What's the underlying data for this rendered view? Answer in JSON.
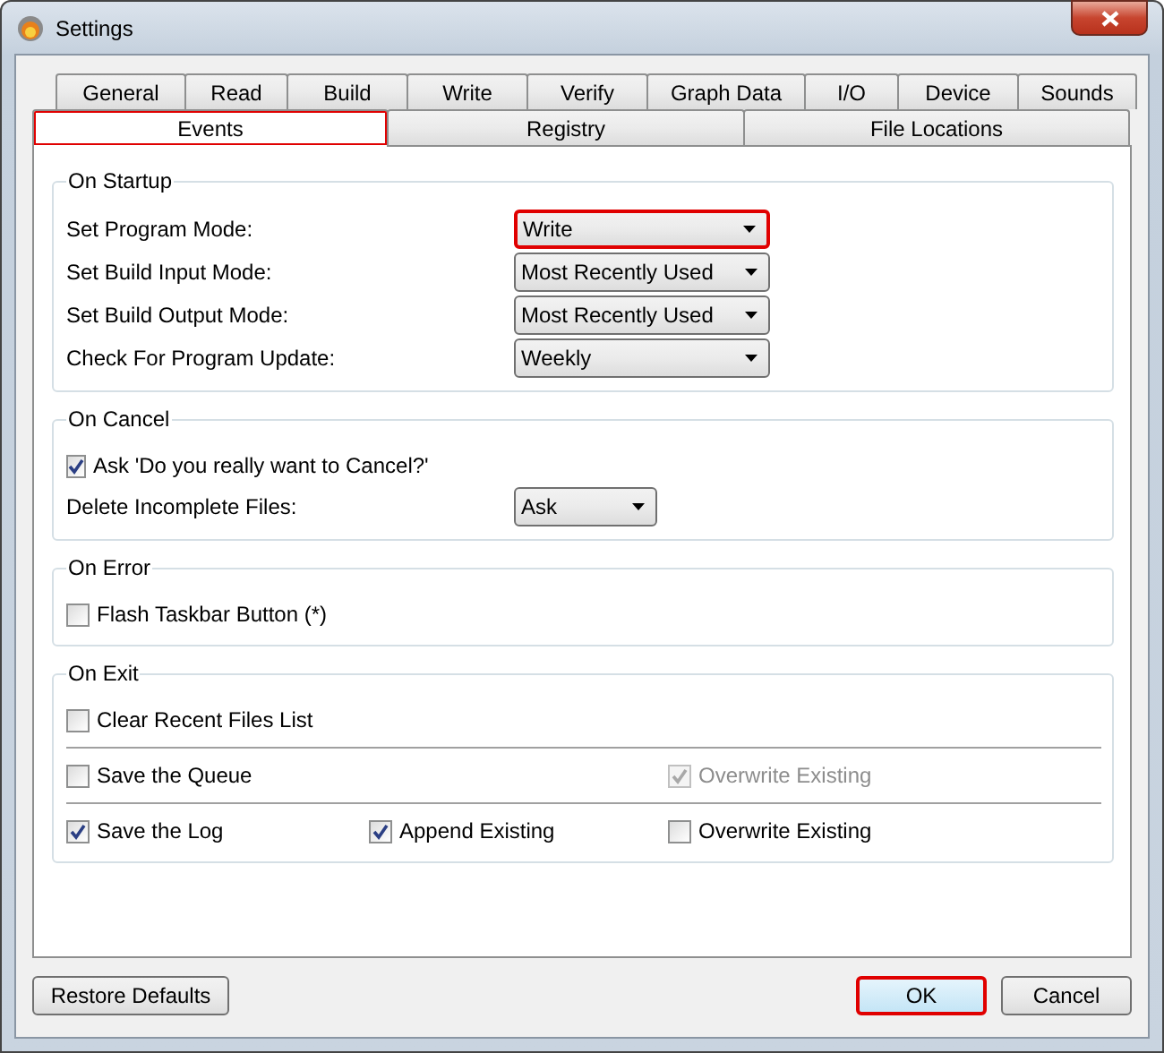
{
  "window": {
    "title": "Settings"
  },
  "tab_rows": [
    {
      "tabs": [
        {
          "label": "General",
          "selected": false,
          "highlighted": false
        },
        {
          "label": "Read",
          "selected": false,
          "highlighted": false
        },
        {
          "label": "Build",
          "selected": false,
          "highlighted": false
        },
        {
          "label": "Write",
          "selected": false,
          "highlighted": false
        },
        {
          "label": "Verify",
          "selected": false,
          "highlighted": false
        },
        {
          "label": "Graph Data",
          "selected": false,
          "highlighted": false
        },
        {
          "label": "I/O",
          "selected": false,
          "highlighted": false
        },
        {
          "label": "Device",
          "selected": false,
          "highlighted": false
        },
        {
          "label": "Sounds",
          "selected": false,
          "highlighted": false
        }
      ]
    },
    {
      "tabs": [
        {
          "label": "Events",
          "selected": true,
          "highlighted": true
        },
        {
          "label": "Registry",
          "selected": false,
          "highlighted": false
        },
        {
          "label": "File Locations",
          "selected": false,
          "highlighted": false
        }
      ]
    }
  ],
  "groups": [
    {
      "title": "On Startup",
      "rows": [
        {
          "kind": "select",
          "label": "Set Program Mode:",
          "value": "Write",
          "highlighted": true
        },
        {
          "kind": "select",
          "label": "Set Build Input Mode:",
          "value": "Most Recently Used",
          "highlighted": false
        },
        {
          "kind": "select",
          "label": "Set Build Output Mode:",
          "value": "Most Recently Used",
          "highlighted": false
        },
        {
          "kind": "select",
          "label": "Check For Program Update:",
          "value": "Weekly",
          "highlighted": false
        }
      ]
    },
    {
      "title": "On Cancel",
      "rows": [
        {
          "kind": "checks",
          "items": [
            {
              "label": "Ask 'Do you really want to Cancel?'",
              "checked": true,
              "disabled": false
            }
          ]
        },
        {
          "kind": "short_select",
          "label": "Delete Incomplete Files:",
          "value": "Ask",
          "highlighted": false
        }
      ]
    },
    {
      "title": "On Error",
      "rows": [
        {
          "kind": "checks",
          "items": [
            {
              "label": "Flash Taskbar Button (*)",
              "checked": false,
              "disabled": false
            }
          ]
        }
      ]
    },
    {
      "title": "On Exit",
      "rows": [
        {
          "kind": "checks",
          "items": [
            {
              "label": "Clear Recent Files List",
              "checked": false,
              "disabled": false
            }
          ]
        },
        {
          "kind": "divider"
        },
        {
          "kind": "checks",
          "items": [
            {
              "label": "Save the Queue",
              "checked": false,
              "disabled": false
            },
            {
              "label": "Overwrite Existing",
              "checked": true,
              "disabled": true
            }
          ]
        },
        {
          "kind": "divider"
        },
        {
          "kind": "checks",
          "items": [
            {
              "label": "Save the Log",
              "checked": true,
              "disabled": false
            },
            {
              "label": "Append Existing",
              "checked": true,
              "disabled": false
            },
            {
              "label": "Overwrite Existing",
              "checked": false,
              "disabled": false
            }
          ]
        }
      ]
    }
  ],
  "buttons": [
    {
      "label": "Restore Defaults",
      "kind": "left",
      "highlighted": false
    },
    {
      "label": "OK",
      "kind": "default",
      "highlighted": true
    },
    {
      "label": "Cancel",
      "kind": "right",
      "highlighted": false
    }
  ]
}
